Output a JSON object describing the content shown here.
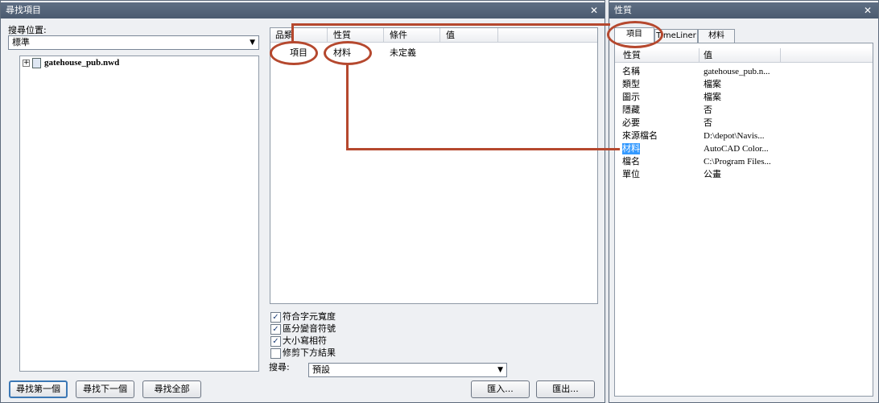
{
  "find_panel": {
    "title": "尋找項目",
    "search_location_label": "搜尋位置:",
    "search_location_value": "標準",
    "tree": {
      "root_label": "gatehouse_pub.nwd"
    },
    "grid": {
      "headers": [
        "品類",
        "性質",
        "條件",
        "值"
      ],
      "row": {
        "category": "項目",
        "property": "材料",
        "condition": "未定義",
        "value": ""
      }
    },
    "options": [
      {
        "label": "符合字元寬度",
        "checked": true
      },
      {
        "label": "區分變音符號",
        "checked": true
      },
      {
        "label": "大小寫相符",
        "checked": true
      },
      {
        "label": "修剪下方結果",
        "checked": false
      }
    ],
    "search_label": "搜尋:",
    "search_mode_value": "預設",
    "buttons": {
      "find_first": "尋找第一個",
      "find_next": "尋找下一個",
      "find_all": "尋找全部",
      "import": "匯入...",
      "export": "匯出..."
    }
  },
  "properties_panel": {
    "title": "性質",
    "tabs": [
      "項目",
      "TimeLiner",
      "材料"
    ],
    "headers": [
      "性質",
      "值"
    ],
    "rows": [
      {
        "property": "名稱",
        "value": "gatehouse_pub.n..."
      },
      {
        "property": "類型",
        "value": "檔案"
      },
      {
        "property": "圖示",
        "value": "檔案"
      },
      {
        "property": "隱藏",
        "value": "否"
      },
      {
        "property": "必要",
        "value": "否"
      },
      {
        "property": "來源檔名",
        "value": "D:\\depot\\Navis..."
      },
      {
        "property": "材料",
        "value": "AutoCAD Color..."
      },
      {
        "property": "檔名",
        "value": "C:\\Program Files..."
      },
      {
        "property": "單位",
        "value": "公畫"
      }
    ]
  },
  "close_symbol": "✕",
  "colors": {
    "annotation": "#b5482e",
    "title_bar": "#55657a",
    "selection": "#3399ff"
  }
}
